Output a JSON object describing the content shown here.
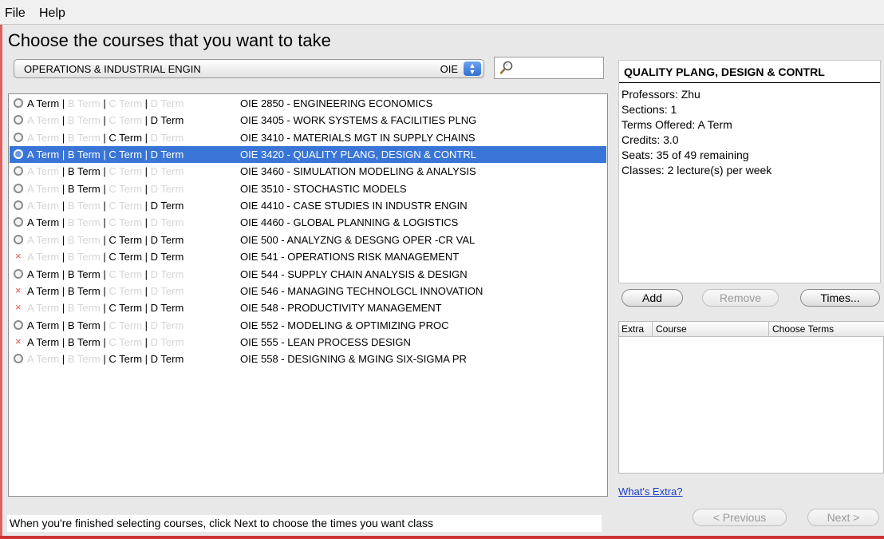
{
  "menu": {
    "file": "File",
    "help": "Help"
  },
  "heading": "Choose the courses that you want to take",
  "department": {
    "name": "OPERATIONS & INDUSTRIAL ENGIN",
    "code": "OIE"
  },
  "search": {
    "value": "",
    "placeholder": ""
  },
  "term_labels": [
    "A Term",
    "B Term",
    "C Term",
    "D Term"
  ],
  "colors": {
    "accent": "#3875d7",
    "inactive_term": "#d5d5d5",
    "unavailable_mark": "#e05050",
    "link": "#1a3cc8"
  },
  "courses": [
    {
      "name": "OIE 2850 - ENGINEERING ECONOMICS",
      "status": "circle",
      "terms": [
        true,
        false,
        false,
        false
      ]
    },
    {
      "name": "OIE 3405 - WORK SYSTEMS & FACILITIES PLNG",
      "status": "circle",
      "terms": [
        false,
        false,
        false,
        true
      ]
    },
    {
      "name": "OIE 3410 - MATERIALS MGT IN SUPPLY CHAINS",
      "status": "circle",
      "terms": [
        false,
        false,
        true,
        false
      ]
    },
    {
      "name": "OIE 3420 - QUALITY PLANG, DESIGN & CONTRL",
      "status": "circle",
      "terms": [
        true,
        true,
        true,
        true
      ],
      "selected": true
    },
    {
      "name": "OIE 3460 - SIMULATION MODELING & ANALYSIS",
      "status": "circle",
      "terms": [
        false,
        true,
        false,
        false
      ]
    },
    {
      "name": "OIE 3510 - STOCHASTIC MODELS",
      "status": "circle",
      "terms": [
        false,
        true,
        false,
        false
      ]
    },
    {
      "name": "OIE 4410 - CASE STUDIES IN INDUSTR ENGIN",
      "status": "circle",
      "terms": [
        false,
        false,
        false,
        true
      ]
    },
    {
      "name": "OIE 4460 - GLOBAL PLANNING & LOGISTICS",
      "status": "circle",
      "terms": [
        true,
        false,
        false,
        false
      ]
    },
    {
      "name": "OIE 500 - ANALYZNG & DESGNG OPER -CR VAL",
      "status": "circle",
      "terms": [
        false,
        false,
        true,
        true
      ]
    },
    {
      "name": "OIE 541 - OPERATIONS RISK MANAGEMENT",
      "status": "cross",
      "terms": [
        false,
        false,
        true,
        true
      ]
    },
    {
      "name": "OIE 544 - SUPPLY CHAIN ANALYSIS & DESIGN",
      "status": "circle",
      "terms": [
        true,
        true,
        false,
        false
      ]
    },
    {
      "name": "OIE 546 - MANAGING TECHNOLGCL INNOVATION",
      "status": "cross",
      "terms": [
        true,
        true,
        false,
        false
      ]
    },
    {
      "name": "OIE 548 - PRODUCTIVITY MANAGEMENT",
      "status": "cross",
      "terms": [
        false,
        false,
        true,
        true
      ]
    },
    {
      "name": "OIE 552 - MODELING & OPTIMIZING PROC",
      "status": "circle",
      "terms": [
        true,
        true,
        false,
        false
      ]
    },
    {
      "name": "OIE 555 - LEAN PROCESS DESIGN",
      "status": "cross",
      "terms": [
        true,
        true,
        false,
        false
      ]
    },
    {
      "name": "OIE 558 - DESIGNING & MGING SIX-SIGMA PR",
      "status": "circle",
      "terms": [
        false,
        false,
        true,
        true
      ]
    }
  ],
  "details": {
    "title": "QUALITY PLANG, DESIGN & CONTRL",
    "professors": "Professors: Zhu",
    "sections": "Sections: 1",
    "terms_offered": "Terms Offered: A Term",
    "credits": "Credits: 3.0",
    "seats": "Seats: 35 of 49 remaining",
    "classes": "Classes: 2 lecture(s) per week"
  },
  "buttons": {
    "add": "Add",
    "remove": "Remove",
    "times": "Times...",
    "previous": "< Previous",
    "next": "Next >"
  },
  "selected_table": {
    "columns": [
      "Extra",
      "Course",
      "Choose Terms"
    ]
  },
  "extra_link": "What's Extra?",
  "status_text": "When you're finished selecting courses, click Next to choose the times you want class"
}
